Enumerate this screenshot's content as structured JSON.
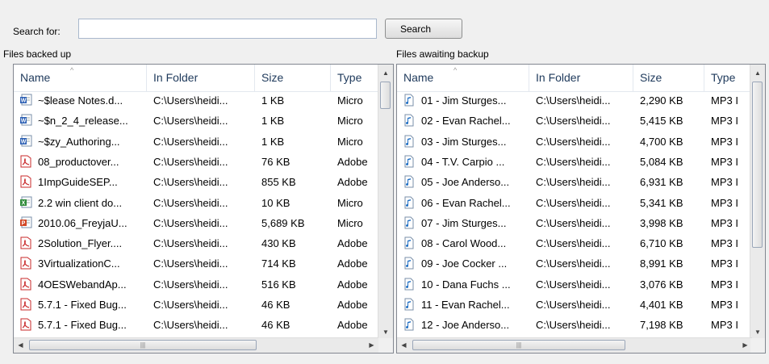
{
  "search": {
    "label": "Search for:",
    "value": "",
    "placeholder": "",
    "button_label": "Search"
  },
  "backed_up": {
    "title": "Files backed up",
    "columns": [
      "Name",
      "In Folder",
      "Size",
      "Type"
    ],
    "rows": [
      {
        "icon": "word-document-icon",
        "name": "~$lease Notes.d...",
        "folder": "C:\\Users\\heidi...",
        "size": "1 KB",
        "type": "Micro"
      },
      {
        "icon": "word-document-icon",
        "name": "~$n_2_4_release...",
        "folder": "C:\\Users\\heidi...",
        "size": "1 KB",
        "type": "Micro"
      },
      {
        "icon": "word-document-icon",
        "name": "~$zy_Authoring...",
        "folder": "C:\\Users\\heidi...",
        "size": "1 KB",
        "type": "Micro"
      },
      {
        "icon": "pdf-document-icon",
        "name": "08_productover...",
        "folder": "C:\\Users\\heidi...",
        "size": "76 KB",
        "type": "Adobe"
      },
      {
        "icon": "pdf-document-icon",
        "name": "1ImpGuideSEP...",
        "folder": "C:\\Users\\heidi...",
        "size": "855 KB",
        "type": "Adobe"
      },
      {
        "icon": "excel-document-icon",
        "name": "2.2 win client do...",
        "folder": "C:\\Users\\heidi...",
        "size": "10 KB",
        "type": "Micro"
      },
      {
        "icon": "powerpoint-document-icon",
        "name": "2010.06_FreyjaU...",
        "folder": "C:\\Users\\heidi...",
        "size": "5,689 KB",
        "type": "Micro"
      },
      {
        "icon": "pdf-document-icon",
        "name": "2Solution_Flyer....",
        "folder": "C:\\Users\\heidi...",
        "size": "430 KB",
        "type": "Adobe"
      },
      {
        "icon": "pdf-document-icon",
        "name": "3VirtualizationC...",
        "folder": "C:\\Users\\heidi...",
        "size": "714 KB",
        "type": "Adobe"
      },
      {
        "icon": "pdf-document-icon",
        "name": "4OESWebandAp...",
        "folder": "C:\\Users\\heidi...",
        "size": "516 KB",
        "type": "Adobe"
      },
      {
        "icon": "pdf-document-icon",
        "name": "5.7.1 - Fixed Bug...",
        "folder": "C:\\Users\\heidi...",
        "size": "46 KB",
        "type": "Adobe"
      },
      {
        "icon": "pdf-document-icon",
        "name": "5.7.1 - Fixed Bug...",
        "folder": "C:\\Users\\heidi...",
        "size": "46 KB",
        "type": "Adobe"
      }
    ]
  },
  "awaiting": {
    "title": "Files awaiting backup",
    "columns": [
      "Name",
      "In Folder",
      "Size",
      "Type"
    ],
    "rows": [
      {
        "icon": "audio-file-icon",
        "name": "01 - Jim Sturges...",
        "folder": "C:\\Users\\heidi...",
        "size": "2,290 KB",
        "type": "MP3 I"
      },
      {
        "icon": "audio-file-icon",
        "name": "02 - Evan Rachel...",
        "folder": "C:\\Users\\heidi...",
        "size": "5,415 KB",
        "type": "MP3 I"
      },
      {
        "icon": "audio-file-icon",
        "name": "03 - Jim Sturges...",
        "folder": "C:\\Users\\heidi...",
        "size": "4,700 KB",
        "type": "MP3 I"
      },
      {
        "icon": "audio-file-icon",
        "name": "04 - T.V. Carpio ...",
        "folder": "C:\\Users\\heidi...",
        "size": "5,084 KB",
        "type": "MP3 I"
      },
      {
        "icon": "audio-file-icon",
        "name": "05 - Joe Anderso...",
        "folder": "C:\\Users\\heidi...",
        "size": "6,931 KB",
        "type": "MP3 I"
      },
      {
        "icon": "audio-file-icon",
        "name": "06 - Evan Rachel...",
        "folder": "C:\\Users\\heidi...",
        "size": "5,341 KB",
        "type": "MP3 I"
      },
      {
        "icon": "audio-file-icon",
        "name": "07 - Jim Sturges...",
        "folder": "C:\\Users\\heidi...",
        "size": "3,998 KB",
        "type": "MP3 I"
      },
      {
        "icon": "audio-file-icon",
        "name": "08 - Carol Wood...",
        "folder": "C:\\Users\\heidi...",
        "size": "6,710 KB",
        "type": "MP3 I"
      },
      {
        "icon": "audio-file-icon",
        "name": "09 - Joe Cocker ...",
        "folder": "C:\\Users\\heidi...",
        "size": "8,991 KB",
        "type": "MP3 I"
      },
      {
        "icon": "audio-file-icon",
        "name": "10 - Dana Fuchs ...",
        "folder": "C:\\Users\\heidi...",
        "size": "3,076 KB",
        "type": "MP3 I"
      },
      {
        "icon": "audio-file-icon",
        "name": "11 - Evan Rachel...",
        "folder": "C:\\Users\\heidi...",
        "size": "4,401 KB",
        "type": "MP3 I"
      },
      {
        "icon": "audio-file-icon",
        "name": "12 - Joe Anderso...",
        "folder": "C:\\Users\\heidi...",
        "size": "7,198 KB",
        "type": "MP3 I"
      }
    ]
  },
  "colors": {
    "header_text": "#1e395b",
    "panel_border": "#828790",
    "window_bg": "#f0f0f0",
    "pdf_icon": "#c8282a",
    "word_icon": "#2b5fb4",
    "excel_icon": "#2e8b3a",
    "powerpoint_icon": "#d24726",
    "audio_icon": "#1f6fc5"
  }
}
